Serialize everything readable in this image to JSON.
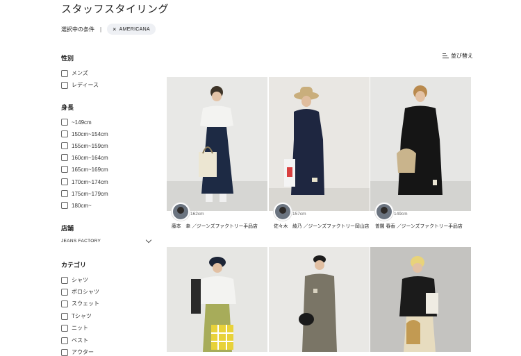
{
  "page": {
    "title": "スタッフスタイリング"
  },
  "filters_selected": {
    "label": "選択中の条件",
    "chips": [
      "AMERICANA"
    ]
  },
  "sort": {
    "label": "並び替え"
  },
  "filters": {
    "gender": {
      "title": "性別",
      "options": [
        "メンズ",
        "レディース"
      ]
    },
    "height": {
      "title": "身長",
      "options": [
        "~149cm",
        "150cm~154cm",
        "155cm~159cm",
        "160cm~164cm",
        "165cm~169cm",
        "170cm~174cm",
        "175cm~179cm",
        "180cm~"
      ]
    },
    "store": {
      "title": "店舗",
      "selected": "JEANS FACTORY"
    },
    "category": {
      "title": "カテゴリ",
      "options": [
        "シャツ",
        "ポロシャツ",
        "スウェット",
        "Tシャツ",
        "ニット",
        "ベスト",
        "アウター"
      ]
    }
  },
  "cards": [
    {
      "height": "162cm",
      "staff": "藤本　幸 ／ジーンズファクトリー手品店"
    },
    {
      "height": "157cm",
      "staff": "佐々木　綾乃 ／ジーンズファクトリー岡山店"
    },
    {
      "height": "149cm",
      "staff": "曽闇 春香 ／ジーンズファクトリー手品店"
    },
    {
      "height": "",
      "staff": ""
    },
    {
      "height": "",
      "staff": ""
    },
    {
      "height": "",
      "staff": ""
    }
  ],
  "colors": {
    "chip_bg": "#eef0f4",
    "text": "#222222"
  }
}
